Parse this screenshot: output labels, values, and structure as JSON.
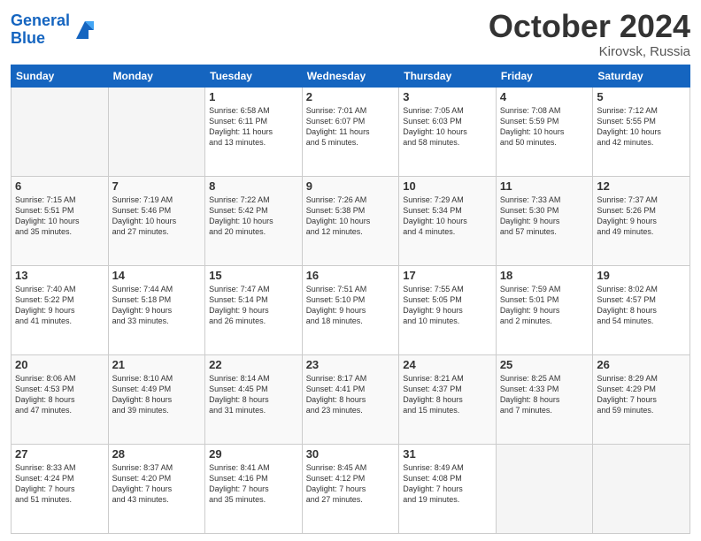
{
  "header": {
    "logo_line1": "General",
    "logo_line2": "Blue",
    "month": "October 2024",
    "location": "Kirovsk, Russia"
  },
  "weekdays": [
    "Sunday",
    "Monday",
    "Tuesday",
    "Wednesday",
    "Thursday",
    "Friday",
    "Saturday"
  ],
  "weeks": [
    [
      {
        "day": "",
        "info": ""
      },
      {
        "day": "",
        "info": ""
      },
      {
        "day": "1",
        "info": "Sunrise: 6:58 AM\nSunset: 6:11 PM\nDaylight: 11 hours\nand 13 minutes."
      },
      {
        "day": "2",
        "info": "Sunrise: 7:01 AM\nSunset: 6:07 PM\nDaylight: 11 hours\nand 5 minutes."
      },
      {
        "day": "3",
        "info": "Sunrise: 7:05 AM\nSunset: 6:03 PM\nDaylight: 10 hours\nand 58 minutes."
      },
      {
        "day": "4",
        "info": "Sunrise: 7:08 AM\nSunset: 5:59 PM\nDaylight: 10 hours\nand 50 minutes."
      },
      {
        "day": "5",
        "info": "Sunrise: 7:12 AM\nSunset: 5:55 PM\nDaylight: 10 hours\nand 42 minutes."
      }
    ],
    [
      {
        "day": "6",
        "info": "Sunrise: 7:15 AM\nSunset: 5:51 PM\nDaylight: 10 hours\nand 35 minutes."
      },
      {
        "day": "7",
        "info": "Sunrise: 7:19 AM\nSunset: 5:46 PM\nDaylight: 10 hours\nand 27 minutes."
      },
      {
        "day": "8",
        "info": "Sunrise: 7:22 AM\nSunset: 5:42 PM\nDaylight: 10 hours\nand 20 minutes."
      },
      {
        "day": "9",
        "info": "Sunrise: 7:26 AM\nSunset: 5:38 PM\nDaylight: 10 hours\nand 12 minutes."
      },
      {
        "day": "10",
        "info": "Sunrise: 7:29 AM\nSunset: 5:34 PM\nDaylight: 10 hours\nand 4 minutes."
      },
      {
        "day": "11",
        "info": "Sunrise: 7:33 AM\nSunset: 5:30 PM\nDaylight: 9 hours\nand 57 minutes."
      },
      {
        "day": "12",
        "info": "Sunrise: 7:37 AM\nSunset: 5:26 PM\nDaylight: 9 hours\nand 49 minutes."
      }
    ],
    [
      {
        "day": "13",
        "info": "Sunrise: 7:40 AM\nSunset: 5:22 PM\nDaylight: 9 hours\nand 41 minutes."
      },
      {
        "day": "14",
        "info": "Sunrise: 7:44 AM\nSunset: 5:18 PM\nDaylight: 9 hours\nand 33 minutes."
      },
      {
        "day": "15",
        "info": "Sunrise: 7:47 AM\nSunset: 5:14 PM\nDaylight: 9 hours\nand 26 minutes."
      },
      {
        "day": "16",
        "info": "Sunrise: 7:51 AM\nSunset: 5:10 PM\nDaylight: 9 hours\nand 18 minutes."
      },
      {
        "day": "17",
        "info": "Sunrise: 7:55 AM\nSunset: 5:05 PM\nDaylight: 9 hours\nand 10 minutes."
      },
      {
        "day": "18",
        "info": "Sunrise: 7:59 AM\nSunset: 5:01 PM\nDaylight: 9 hours\nand 2 minutes."
      },
      {
        "day": "19",
        "info": "Sunrise: 8:02 AM\nSunset: 4:57 PM\nDaylight: 8 hours\nand 54 minutes."
      }
    ],
    [
      {
        "day": "20",
        "info": "Sunrise: 8:06 AM\nSunset: 4:53 PM\nDaylight: 8 hours\nand 47 minutes."
      },
      {
        "day": "21",
        "info": "Sunrise: 8:10 AM\nSunset: 4:49 PM\nDaylight: 8 hours\nand 39 minutes."
      },
      {
        "day": "22",
        "info": "Sunrise: 8:14 AM\nSunset: 4:45 PM\nDaylight: 8 hours\nand 31 minutes."
      },
      {
        "day": "23",
        "info": "Sunrise: 8:17 AM\nSunset: 4:41 PM\nDaylight: 8 hours\nand 23 minutes."
      },
      {
        "day": "24",
        "info": "Sunrise: 8:21 AM\nSunset: 4:37 PM\nDaylight: 8 hours\nand 15 minutes."
      },
      {
        "day": "25",
        "info": "Sunrise: 8:25 AM\nSunset: 4:33 PM\nDaylight: 8 hours\nand 7 minutes."
      },
      {
        "day": "26",
        "info": "Sunrise: 8:29 AM\nSunset: 4:29 PM\nDaylight: 7 hours\nand 59 minutes."
      }
    ],
    [
      {
        "day": "27",
        "info": "Sunrise: 8:33 AM\nSunset: 4:24 PM\nDaylight: 7 hours\nand 51 minutes."
      },
      {
        "day": "28",
        "info": "Sunrise: 8:37 AM\nSunset: 4:20 PM\nDaylight: 7 hours\nand 43 minutes."
      },
      {
        "day": "29",
        "info": "Sunrise: 8:41 AM\nSunset: 4:16 PM\nDaylight: 7 hours\nand 35 minutes."
      },
      {
        "day": "30",
        "info": "Sunrise: 8:45 AM\nSunset: 4:12 PM\nDaylight: 7 hours\nand 27 minutes."
      },
      {
        "day": "31",
        "info": "Sunrise: 8:49 AM\nSunset: 4:08 PM\nDaylight: 7 hours\nand 19 minutes."
      },
      {
        "day": "",
        "info": ""
      },
      {
        "day": "",
        "info": ""
      }
    ]
  ]
}
